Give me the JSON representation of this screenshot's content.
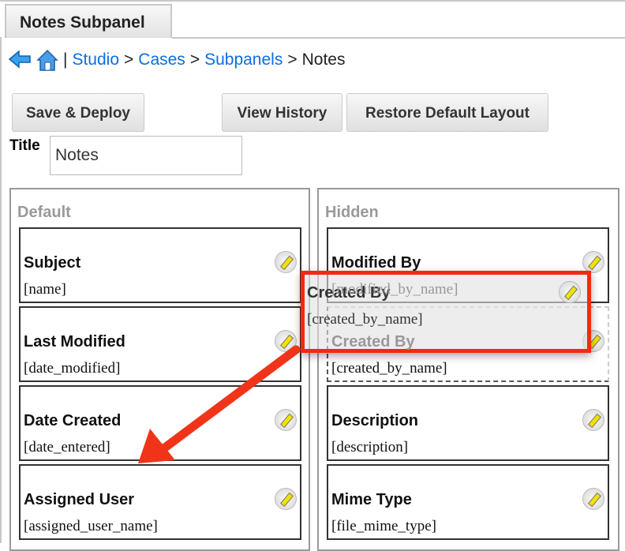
{
  "tab": {
    "label": "Notes Subpanel"
  },
  "breadcrumb": {
    "sep": "|",
    "items": [
      {
        "label": "Studio",
        "link": true
      },
      {
        "label": "Cases",
        "link": true
      },
      {
        "label": "Subpanels",
        "link": true
      },
      {
        "label": "Notes",
        "link": false
      }
    ],
    "arrow": ">"
  },
  "toolbar": {
    "save": "Save & Deploy",
    "history": "View History",
    "restore": "Restore Default Layout"
  },
  "title": {
    "label": "Title",
    "value": "Notes"
  },
  "default": {
    "title": "Default",
    "items": [
      {
        "label": "Subject",
        "field": "[name]"
      },
      {
        "label": "Last Modified",
        "field": "[date_modified]"
      },
      {
        "label": "Date Created",
        "field": "[date_entered]"
      },
      {
        "label": "Assigned User",
        "field": "[assigned_user_name]"
      }
    ]
  },
  "hidden": {
    "title": "Hidden",
    "items": [
      {
        "label": "Modified By",
        "field": "[modified_by_name]"
      },
      {
        "label": "Created By",
        "field": "[created_by_name]"
      },
      {
        "label": "Description",
        "field": "[description]"
      },
      {
        "label": "Mime Type",
        "field": "[file_mime_type]"
      }
    ]
  },
  "drag": {
    "label": "Created By",
    "field": "[created_by_name]"
  },
  "colors": {
    "link": "#0b6ee0",
    "highlight": "#f5290f"
  }
}
